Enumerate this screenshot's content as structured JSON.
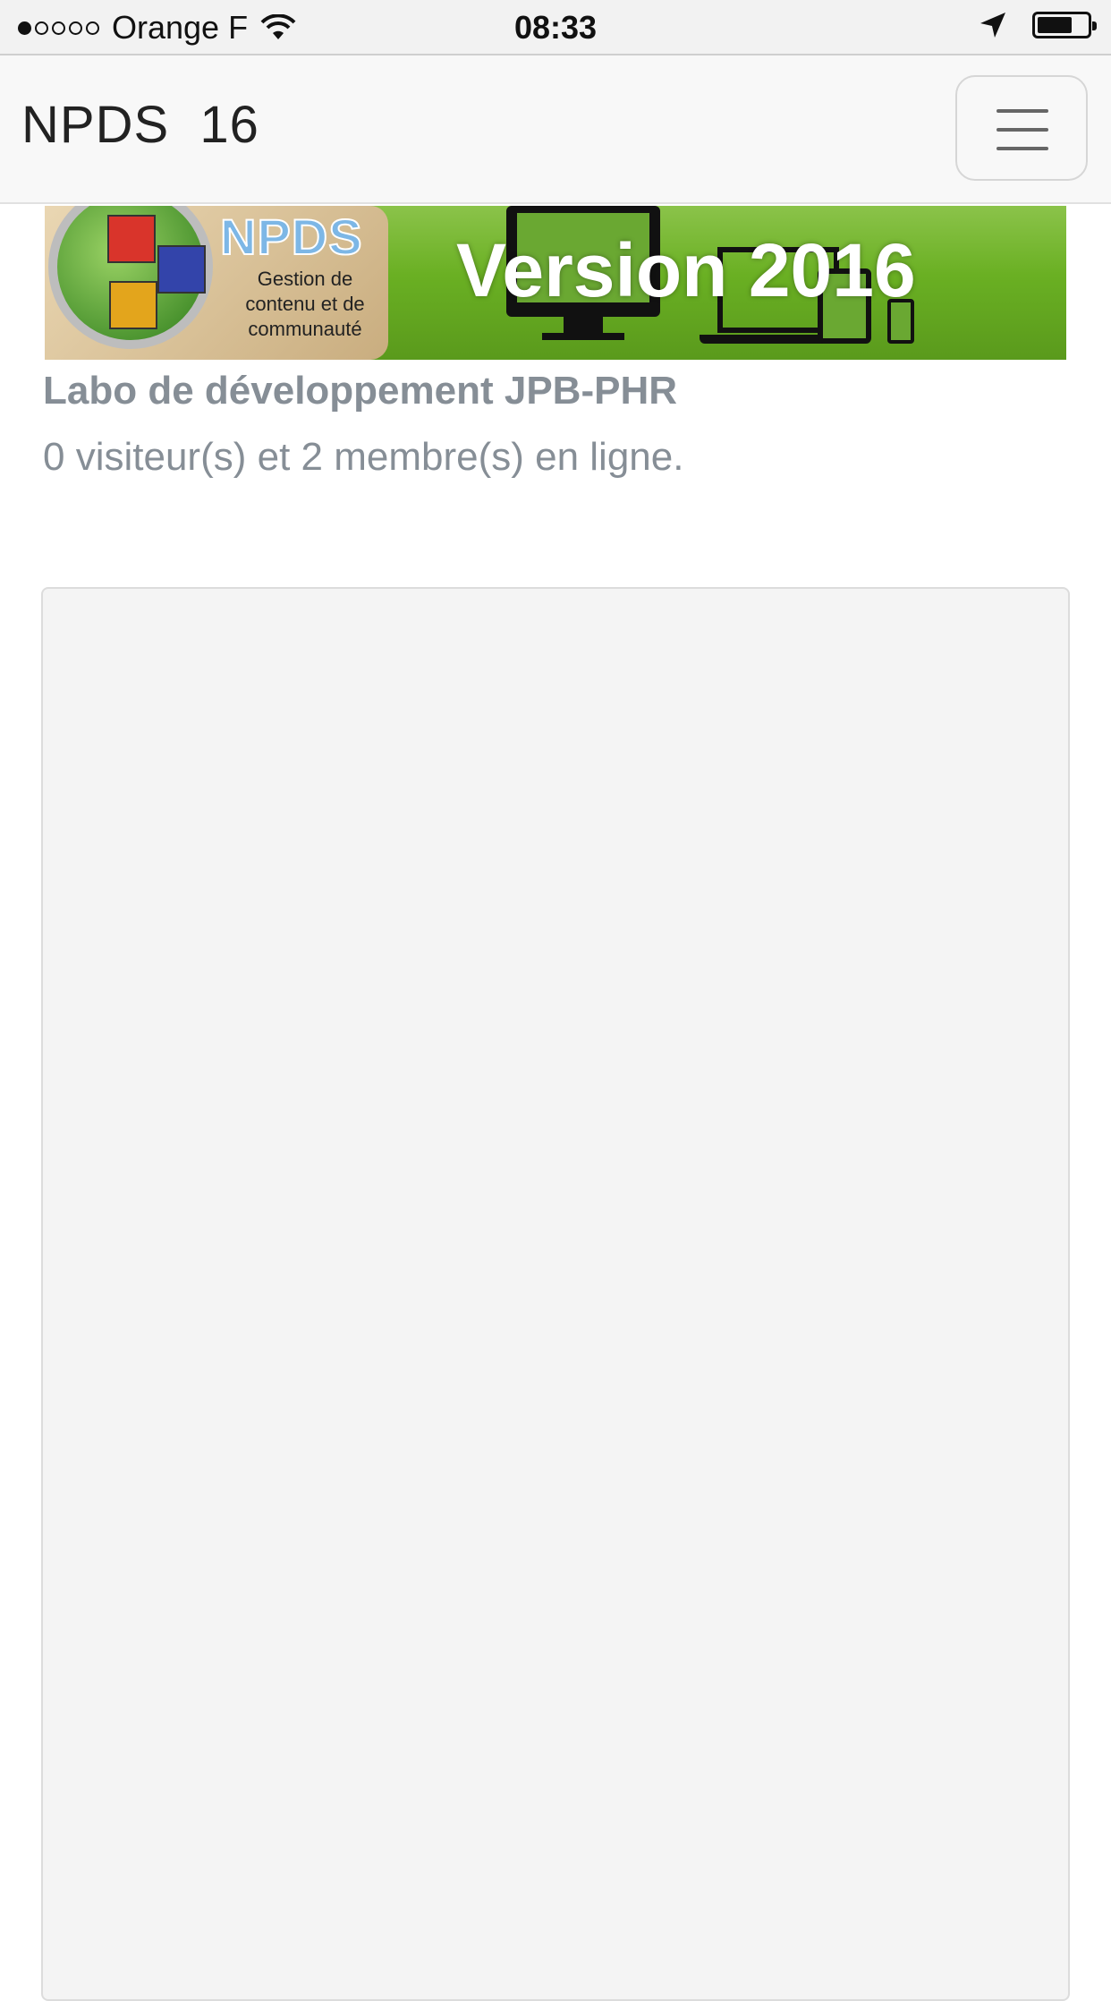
{
  "status_bar": {
    "signal_dots": [
      true,
      false,
      false,
      false,
      false
    ],
    "carrier": "Orange F",
    "time": "08:33",
    "battery_level": 0.7
  },
  "navbar": {
    "brand": "NPDS  16",
    "menu_icon": "hamburger-icon"
  },
  "banner": {
    "logo_text": "NPDS",
    "tagline_lines": [
      "Gestion de",
      "contenu et de",
      "communauté"
    ],
    "version_text": "Version 2016",
    "colors": {
      "green": "#6ab023",
      "beige": "#d9c39a"
    }
  },
  "site": {
    "title": "Labo de développement JPB-PHR",
    "online_status": "0 visiteur(s) et 2 membre(s) en ligne."
  },
  "colors": {
    "muted_text": "#868e96",
    "panel_bg": "#f4f4f4",
    "navbar_bg": "#f8f8f8"
  }
}
